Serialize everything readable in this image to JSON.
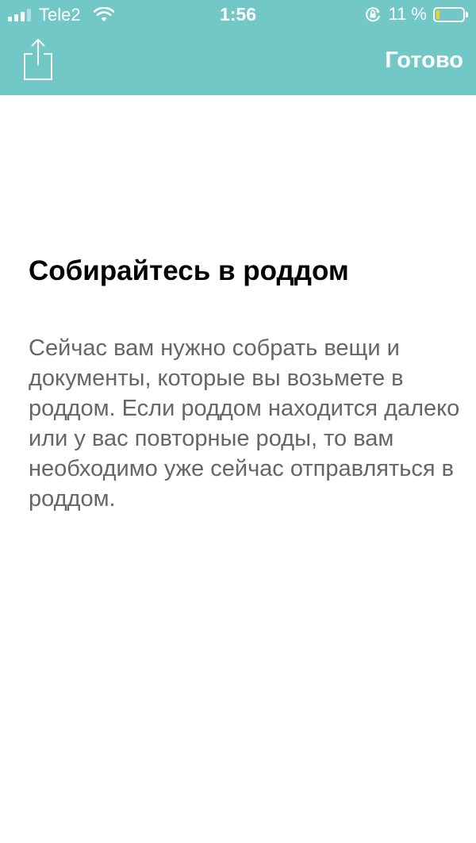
{
  "status_bar": {
    "carrier": "Tele2",
    "time": "1:56",
    "battery_percent": "11 %",
    "battery_level": 0.11,
    "signal_bars": 3,
    "battery_fill_color": "#f7d21c",
    "icons": [
      "signal-icon",
      "wifi-icon",
      "rotation-lock-icon",
      "battery-icon"
    ]
  },
  "nav_bar": {
    "background_color": "#72c7c7",
    "share_icon": "share-icon",
    "done_label": "Готово"
  },
  "content": {
    "title": "Собирайтесь в роддом",
    "body": "Сейчас вам нужно собрать вещи и документы, которые вы возьмете в роддом. Если роддом находится далеко или у вас повторные роды, то вам необходимо уже сейчас отправляться в роддом."
  }
}
